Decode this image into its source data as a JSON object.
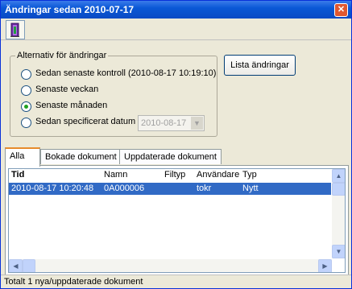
{
  "window": {
    "title": "Ändringar sedan 2010-07-17"
  },
  "toolbar": {
    "icon": "door-exit-icon"
  },
  "alternatives": {
    "legend": "Alternativ för ändringar",
    "options": [
      {
        "label": "Sedan senaste kontroll  (2010-08-17 10:19:10)",
        "selected": false
      },
      {
        "label": "Senaste veckan",
        "selected": false
      },
      {
        "label": "Senaste månaden",
        "selected": true
      },
      {
        "label": "Sedan specificerat datum",
        "selected": false
      }
    ],
    "date_value": "2010-08-17"
  },
  "list_button": "Lista ändringar",
  "tabs": [
    "Alla",
    "Bokade dokument",
    "Uppdaterade dokument"
  ],
  "table": {
    "headers": [
      "Tid",
      "Namn",
      "Filtyp",
      "Användare",
      "Typ"
    ],
    "rows": [
      [
        "2010-08-17 10:20:48",
        "0A000006",
        "",
        "tokr",
        "Nytt"
      ]
    ]
  },
  "status": "Totalt 1 nya/uppdaterade dokument"
}
